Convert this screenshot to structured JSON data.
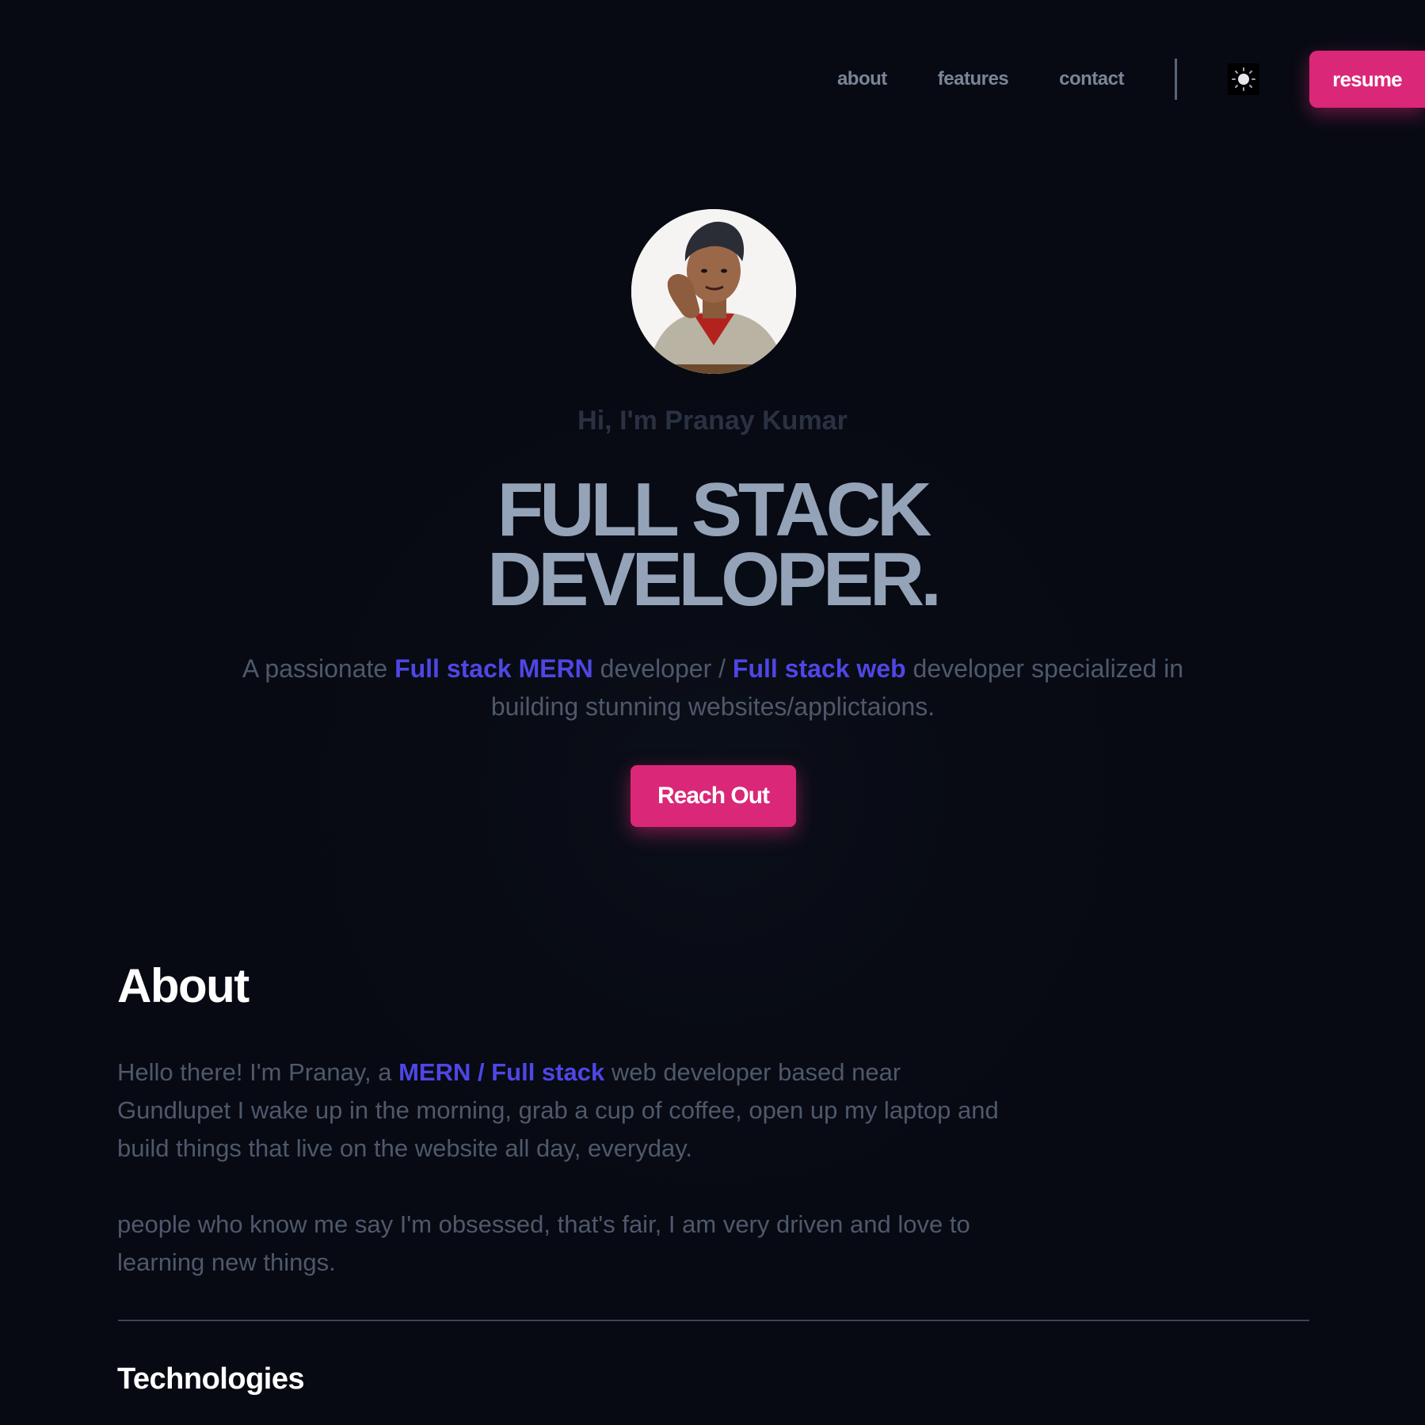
{
  "nav": {
    "links": [
      "about",
      "features",
      "contact"
    ],
    "theme_icon": "sun-icon",
    "resume_label": "resume"
  },
  "hero": {
    "greeting": "Hi, I'm Pranay Kumar",
    "headline_line1": "FULL STACK",
    "headline_line2": "DEVELOPER.",
    "tagline": {
      "part1": "A passionate ",
      "highlight1": "Full stack MERN",
      "part2": " developer / ",
      "highlight2": "Full stack web",
      "part3": " developer specialized in building stunning websites/applictaions."
    },
    "cta_label": "Reach Out"
  },
  "about": {
    "title": "About",
    "p1": {
      "before": "Hello there! I'm Pranay, a ",
      "highlight": "MERN / Full stack",
      "after": " web developer based near Gundlupet I wake up in the morning, grab a cup of coffee, open up my laptop and build things that live on the website all day, everyday."
    },
    "p2": "people who know me say I'm obsessed, that's fair, I am very driven and love to learning new things."
  },
  "technologies": {
    "title": "Technologies"
  },
  "colors": {
    "background": "#070a13",
    "accent_pink": "#db2777",
    "accent_indigo": "#4f46e5",
    "headline": "#94a3b8",
    "muted_text": "#4f586b"
  }
}
